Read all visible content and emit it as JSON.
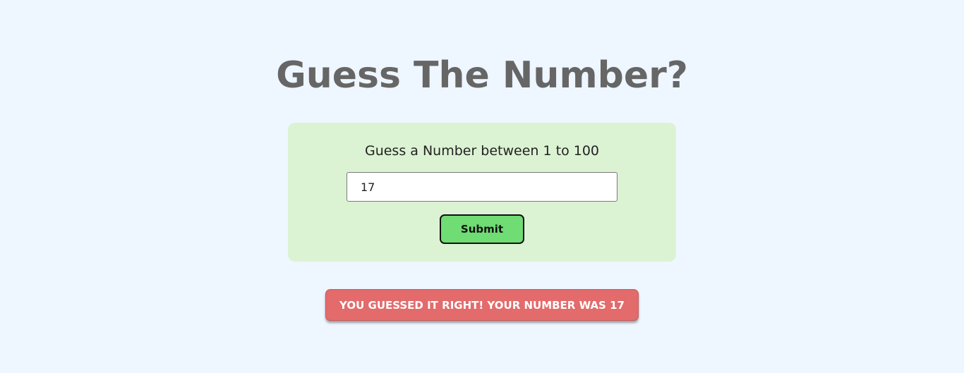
{
  "title": "Guess The Number?",
  "card": {
    "prompt": "Guess a Number between 1 to 100",
    "input_value": "17",
    "submit_label": "Submit"
  },
  "result": {
    "message": "YOU GUESSED IT RIGHT! YOUR NUMBER WAS 17"
  },
  "colors": {
    "background": "#eef6ff",
    "card_background": "#dcf3d3",
    "submit_background": "#70dc74",
    "result_background": "#e36b6b",
    "title_text": "#666666"
  }
}
